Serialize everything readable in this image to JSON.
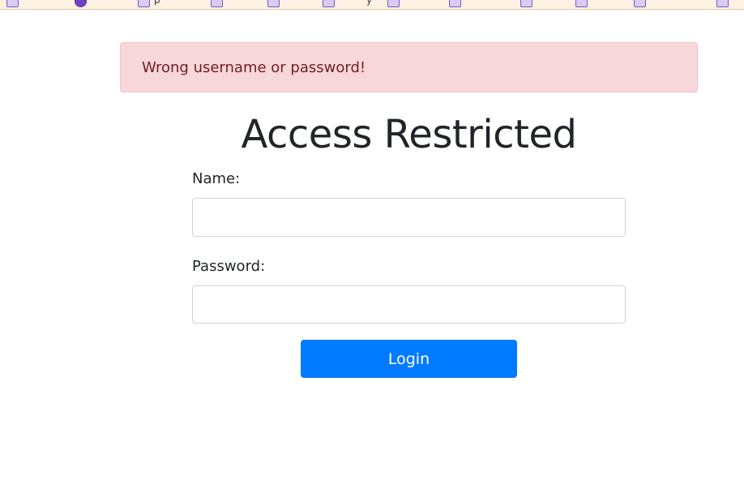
{
  "alert": {
    "message": "Wrong username or password!",
    "color": "#f8d7da"
  },
  "form": {
    "title": "Access Restricted",
    "name_label": "Name:",
    "name_value": "",
    "password_label": "Password:",
    "password_value": "",
    "login_label": "Login",
    "accent_color": "#007bff"
  },
  "bookmarks": {
    "icon_name": "bookmark-icon",
    "fragments": [
      "p",
      "y"
    ]
  }
}
